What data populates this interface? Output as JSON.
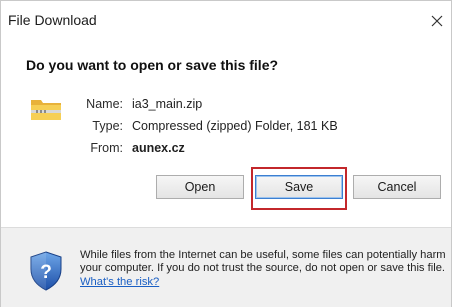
{
  "window": {
    "title": "File Download",
    "close_icon": "close-icon"
  },
  "prompt": {
    "question": "Do you want to open or save this file?"
  },
  "file_info": {
    "icon": "folder-zip-icon",
    "name_label": "Name:",
    "name_value": "ia3_main.zip",
    "type_label": "Type:",
    "type_value": "Compressed (zipped) Folder, 181 KB",
    "from_label": "From:",
    "from_value": "aunex.cz"
  },
  "buttons": {
    "open_label": "Open",
    "save_label": "Save",
    "cancel_label": "Cancel"
  },
  "annotation": {
    "highlight_color": "#c3272b"
  },
  "footer": {
    "icon": "shield-question-icon",
    "warning_text": "While files from the Internet can be useful, some files can potentially harm your computer. If you do not trust the source, do not open or save this file.",
    "link_text": "What's the risk?"
  },
  "colors": {
    "link": "#1a5fc4",
    "footer_bg": "#f0f0f0",
    "default_button_border": "#3c7fd1"
  }
}
